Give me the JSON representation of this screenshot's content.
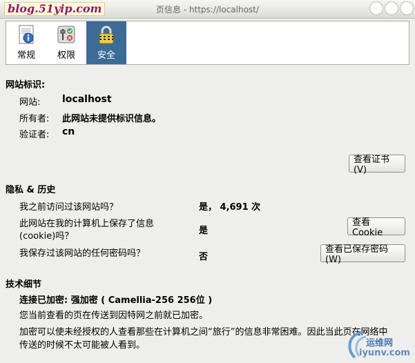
{
  "window": {
    "watermark": "blog.51yip.com",
    "title": "页信息 - https://localhost/"
  },
  "tabs": [
    {
      "label": "常规",
      "icon": "info-document-icon"
    },
    {
      "label": "权限",
      "icon": "permissions-switch-icon"
    },
    {
      "label": "安全",
      "icon": "lock-icon",
      "active": true
    }
  ],
  "identity": {
    "heading": "网站标识:",
    "site_label": "网站:",
    "site_value": "localhost",
    "owner_label": "所有者:",
    "owner_value": "此网站未提供标识信息。",
    "verifier_label": "验证者:",
    "verifier_value": "cn",
    "view_cert_button": "查看证书(V)"
  },
  "privacy": {
    "heading": "隐私 & 历史",
    "visited_q": "我之前访问过该网站吗？",
    "visited_a": "是， 4,691 次",
    "cookie_q_line1": "此网站在我的计算机上保存了信息",
    "cookie_q_line2": "(cookie)吗？",
    "cookie_a": "是",
    "view_cookie_button": "查看 Cookie",
    "password_q": "我保存过该网站的任何密码吗？",
    "password_a": "否",
    "view_passwords_button": "查看已保存密码(W)"
  },
  "technical": {
    "heading": "技术细节",
    "encryption": "连接已加密: 强加密 ( Camellia-256 256位 )",
    "line1": "您当前查看的页在传送到因特网之前就已加密。",
    "line2": "加密可以使未经授权的人查看那些在计算机之间“旅行”的信息非常困难。因此当此页在网络中",
    "line3": "传送的时候不太可能被人看到。"
  },
  "corner_logo": {
    "cn": "运维网",
    "en": "iyunv.com"
  },
  "colors": {
    "active_tab": "#3d6b96",
    "window_bg": "#eeeeec"
  }
}
